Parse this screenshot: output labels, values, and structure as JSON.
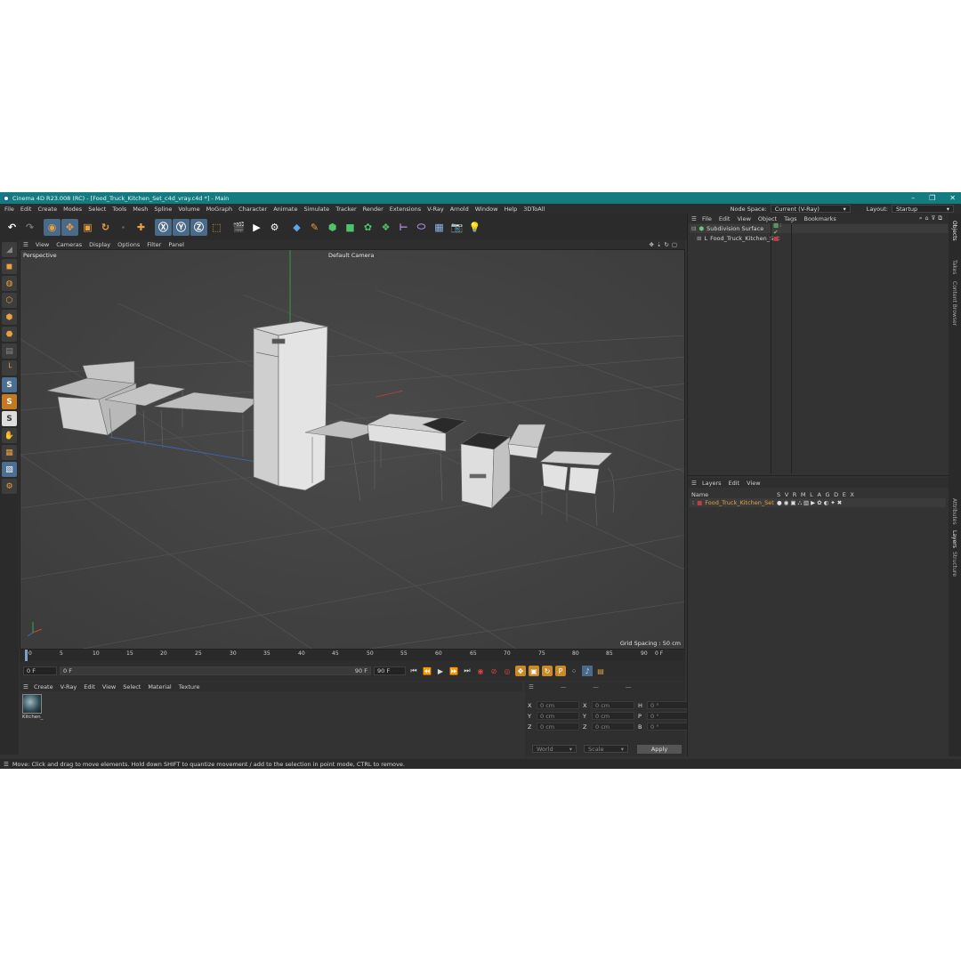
{
  "window": {
    "title": "Cinema 4D R23.008 (RC) - [Food_Truck_Kitchen_Set_c4d_vray.c4d *] - Main",
    "controls": [
      "–",
      "❐",
      "✕"
    ]
  },
  "menubar": {
    "items": [
      "File",
      "Edit",
      "Create",
      "Modes",
      "Select",
      "Tools",
      "Mesh",
      "Spline",
      "Volume",
      "MoGraph",
      "Character",
      "Animate",
      "Simulate",
      "Tracker",
      "Render",
      "Extensions",
      "V-Ray",
      "Arnold",
      "Window",
      "Help",
      "3DToAll"
    ],
    "node_space_label": "Node Space:",
    "node_space_value": "Current (V-Ray)",
    "layout_label": "Layout:",
    "layout_value": "Startup"
  },
  "viewport": {
    "menu": [
      "View",
      "Cameras",
      "Display",
      "Options",
      "Filter",
      "Panel"
    ],
    "projection": "Perspective",
    "camera": "Default Camera",
    "grid_spacing": "Grid Spacing : 50 cm"
  },
  "timeline": {
    "ticks": [
      "0",
      "5",
      "10",
      "15",
      "20",
      "25",
      "30",
      "35",
      "40",
      "45",
      "50",
      "55",
      "60",
      "65",
      "70",
      "75",
      "80",
      "85",
      "90"
    ],
    "end_frame": "0 F"
  },
  "playbar": {
    "start_field": "0 F",
    "current_field": "0 F",
    "end_field": "90 F",
    "end_field2": "90 F"
  },
  "material_manager": {
    "menu": [
      "Create",
      "V-Ray",
      "Edit",
      "View",
      "Select",
      "Material",
      "Texture"
    ],
    "materials": [
      "Kitchen_"
    ]
  },
  "coordinates": {
    "rows": [
      {
        "a": "X",
        "av": "0 cm",
        "b": "X",
        "bv": "0 cm",
        "c": "H",
        "cv": "0 °"
      },
      {
        "a": "Y",
        "av": "0 cm",
        "b": "Y",
        "bv": "0 cm",
        "c": "P",
        "cv": "0 °"
      },
      {
        "a": "Z",
        "av": "0 cm",
        "b": "Z",
        "bv": "0 cm",
        "c": "B",
        "cv": "0 °"
      }
    ],
    "mode1": "World",
    "mode2": "Scale",
    "apply": "Apply"
  },
  "object_manager": {
    "menu": [
      "File",
      "Edit",
      "View",
      "Object",
      "Tags",
      "Bookmarks"
    ],
    "objects": [
      {
        "name": "Subdivision Surface",
        "color": "#6ec27a"
      },
      {
        "name": "Food_Truck_Kitchen_Set",
        "color": "#d8d8d8"
      }
    ]
  },
  "layer_manager": {
    "menu": [
      "Layers",
      "Edit",
      "View"
    ],
    "columns": [
      "Name",
      "S",
      "V",
      "R",
      "M",
      "L",
      "A",
      "G",
      "D",
      "E",
      "X"
    ],
    "layers": [
      {
        "name": "Food_Truck_Kitchen_Set",
        "color": "#e8a040"
      }
    ]
  },
  "side_tabs": [
    "Objects",
    "Takes",
    "Content Browser",
    "Attributes",
    "Layers",
    "Structure"
  ],
  "status": "Move: Click and drag to move elements. Hold down SHIFT to quantize movement / add to the selection in point mode, CTRL to remove.",
  "colors": {
    "titlebar": "#127c80",
    "accent_orange": "#e8a040",
    "highlight_blue": "#4a6a8a"
  }
}
